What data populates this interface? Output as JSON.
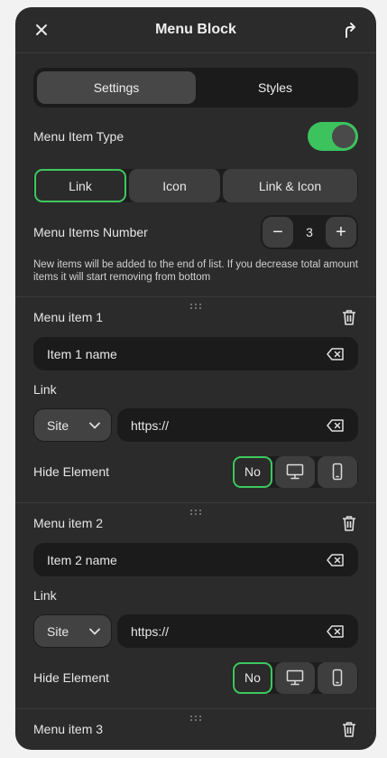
{
  "header": {
    "title": "Menu Block",
    "close_icon": "close-icon",
    "pin_icon": "pin-icon"
  },
  "tabs": [
    {
      "label": "Settings",
      "active": true
    },
    {
      "label": "Styles",
      "active": false
    }
  ],
  "menu_item_type": {
    "label": "Menu Item Type",
    "toggle_on": true,
    "accent": "#3cc35e"
  },
  "type_options": [
    {
      "label": "Link",
      "active": true
    },
    {
      "label": "Icon",
      "active": false
    },
    {
      "label": "Link & Icon",
      "active": false
    }
  ],
  "items_number": {
    "label": "Menu Items Number",
    "value": "3",
    "minus": "−",
    "plus": "+"
  },
  "hint": "New items will be added to the end of list. If you decrease total amount items it will start removing from bottom",
  "menu_items": [
    {
      "title": "Menu item 1",
      "name_value": "Item 1 name",
      "link_label": "Link",
      "select_value": "Site",
      "url_value": "https://",
      "hide_label": "Hide Element",
      "hide_no": "No"
    },
    {
      "title": "Menu item 2",
      "name_value": "Item 2 name",
      "link_label": "Link",
      "select_value": "Site",
      "url_value": "https://",
      "hide_label": "Hide Element",
      "hide_no": "No"
    },
    {
      "title": "Menu item 3"
    }
  ]
}
